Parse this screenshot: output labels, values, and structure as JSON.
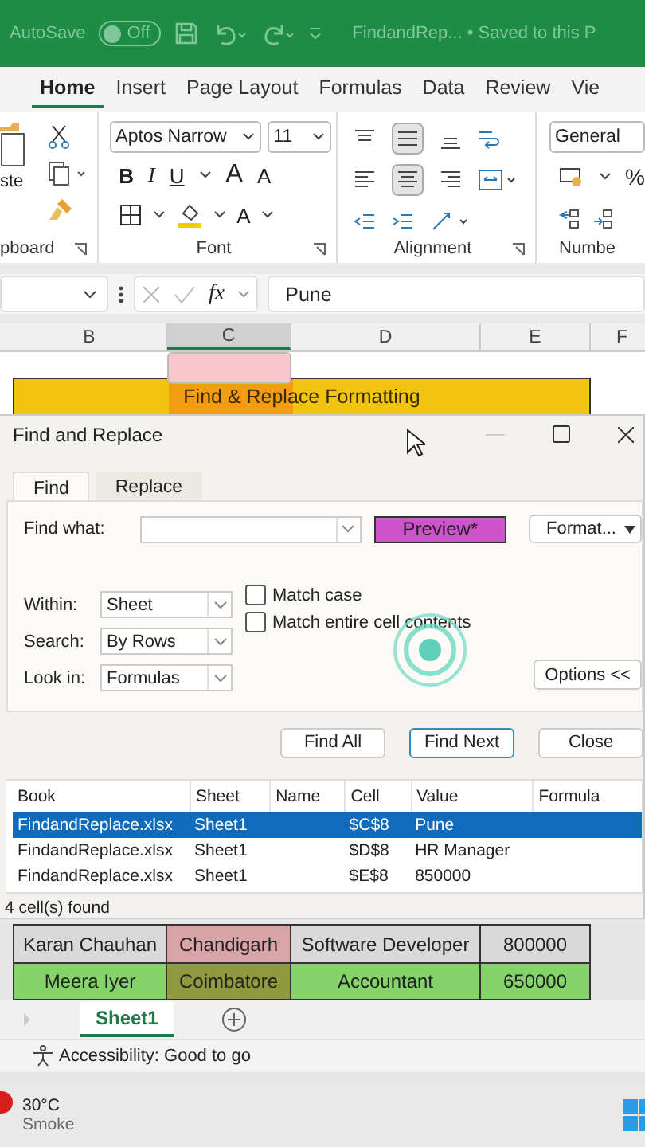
{
  "title_bar": {
    "autosave_label": "AutoSave",
    "autosave_on": false,
    "toggle_text": "Off",
    "document": "FindandRep... • Saved to this P"
  },
  "ribbon_tabs": [
    {
      "label": "Home",
      "selected": true
    },
    {
      "label": "Insert",
      "selected": false
    },
    {
      "label": "Page Layout",
      "selected": false
    },
    {
      "label": "Formulas",
      "selected": false
    },
    {
      "label": "Data",
      "selected": false
    },
    {
      "label": "Review",
      "selected": false
    },
    {
      "label": "Vie",
      "selected": false
    }
  ],
  "ribbon": {
    "clipboard": {
      "paste_label": "ste",
      "group_label": "pboard"
    },
    "font": {
      "font_name": "Aptos Narrow",
      "font_size": "11",
      "bold": "B",
      "italic": "I",
      "underline": "U",
      "grow": "A",
      "shrink": "A",
      "font_color": "A",
      "group_label": "Font"
    },
    "alignment": {
      "group_label": "Alignment"
    },
    "number": {
      "format": "General",
      "percent": "%",
      "group_label": "Numbe"
    }
  },
  "formula_bar": {
    "fx": "fx",
    "value": "Pune"
  },
  "columns": [
    {
      "label": "B",
      "selected": false
    },
    {
      "label": "C",
      "selected": true
    },
    {
      "label": "D",
      "selected": false
    },
    {
      "label": "E",
      "selected": false
    },
    {
      "label": "F",
      "selected": false
    }
  ],
  "banner": "Find & Replace Formatting",
  "dialog": {
    "title": "Find and Replace",
    "tabs": [
      {
        "label": "Find",
        "selected": true
      },
      {
        "label": "Replace",
        "selected": false
      }
    ],
    "find_label": "Find what:",
    "preview": "Preview*",
    "format_button": "Format...",
    "options": [
      {
        "label": "Within:",
        "value": "Sheet"
      },
      {
        "label": "Search:",
        "value": "By Rows"
      },
      {
        "label": "Look in:",
        "value": "Formulas"
      }
    ],
    "checkboxes": [
      {
        "label": "Match case",
        "checked": false
      },
      {
        "label": "Match entire cell contents",
        "checked": false
      }
    ],
    "options_button": "Options <<",
    "buttons": [
      {
        "label": "Find All",
        "default": false
      },
      {
        "label": "Find Next",
        "default": true
      },
      {
        "label": "Close",
        "default": false
      }
    ],
    "results": {
      "columns": [
        "Book",
        "Sheet",
        "Name",
        "Cell",
        "Value",
        "Formula"
      ],
      "rows": [
        {
          "cells": [
            "FindandReplace.xlsx",
            "Sheet1",
            "",
            "$C$8",
            "Pune",
            ""
          ],
          "selected": true
        },
        {
          "cells": [
            "FindandReplace.xlsx",
            "Sheet1",
            "",
            "$D$8",
            "HR Manager",
            ""
          ],
          "selected": false
        },
        {
          "cells": [
            "FindandReplace.xlsx",
            "Sheet1",
            "",
            "$E$8",
            "850000",
            ""
          ],
          "selected": false
        }
      ]
    },
    "found": "4 cell(s) found"
  },
  "sheet_rows": [
    {
      "cells": [
        {
          "text": "Karan Chauhan",
          "color": "#d9d9d9"
        },
        {
          "text": "Chandigarh",
          "color": "#d9a3a8"
        },
        {
          "text": "Software Developer",
          "color": "#d9d9d9"
        },
        {
          "text": "800000",
          "color": "#d9d9d9"
        }
      ]
    },
    {
      "cells": [
        {
          "text": "Meera Iyer",
          "color": "#86d36c"
        },
        {
          "text": "Coimbatore",
          "color": "#8f9a40"
        },
        {
          "text": "Accountant",
          "color": "#86d36c"
        },
        {
          "text": "650000",
          "color": "#86d36c"
        }
      ]
    }
  ],
  "sheet_tabs": [
    {
      "label": "Sheet1",
      "selected": true
    }
  ],
  "status": "Accessibility: Good to go",
  "taskbar": {
    "temperature": "30°C",
    "condition": "Smoke"
  }
}
